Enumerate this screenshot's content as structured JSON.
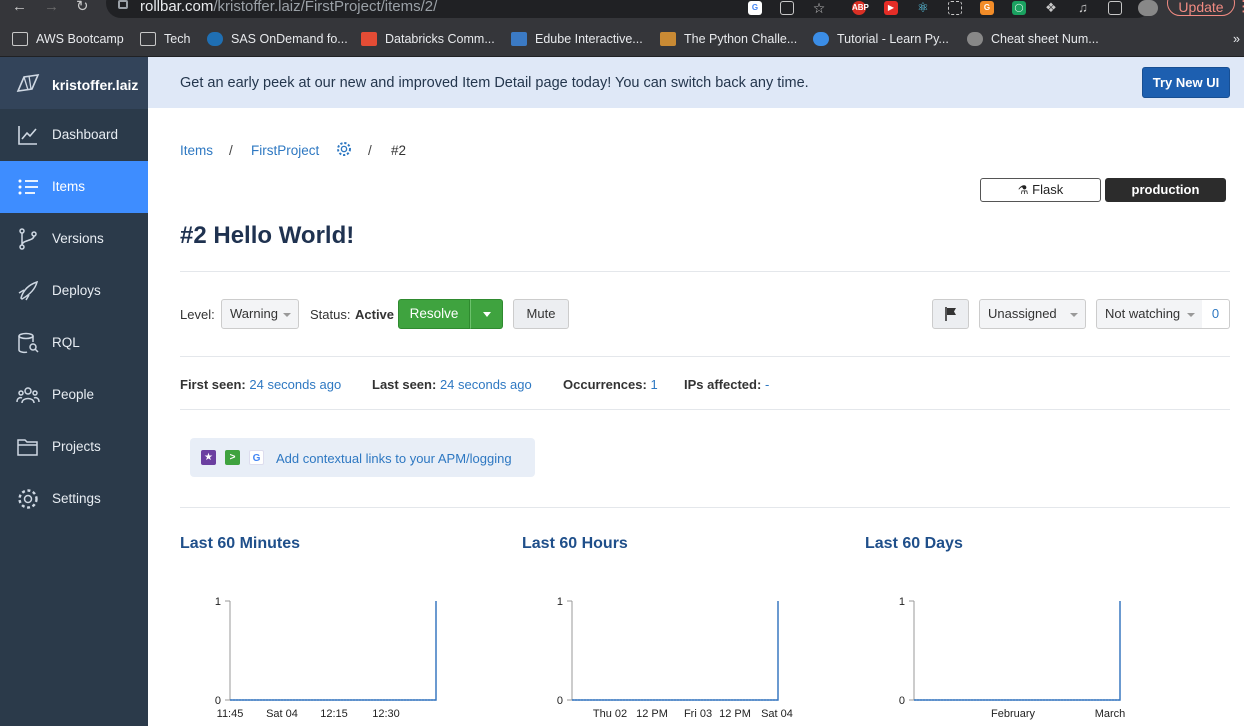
{
  "browser": {
    "url_host": "rollbar.com",
    "url_path": "/kristoffer.laiz/FirstProject/items/2/",
    "update_label": "Update",
    "bookmarks": [
      {
        "label": "AWS Bootcamp",
        "icon": "folder-icon"
      },
      {
        "label": "Tech",
        "icon": "folder-icon"
      },
      {
        "label": "SAS OnDemand fo...",
        "icon": "sas-icon"
      },
      {
        "label": "Databricks Comm...",
        "icon": "databricks-icon"
      },
      {
        "label": "Edube Interactive...",
        "icon": "edube-icon"
      },
      {
        "label": "The Python Challe...",
        "icon": "python-challenge-icon"
      },
      {
        "label": "Tutorial - Learn Py...",
        "icon": "tutorial-icon"
      },
      {
        "label": "Cheat sheet Num...",
        "icon": "globe-icon"
      }
    ],
    "more_label": "»"
  },
  "sidebar": {
    "account": "kristoffer.laiz",
    "items": [
      {
        "label": "Dashboard",
        "icon": "chart-icon",
        "active": false
      },
      {
        "label": "Items",
        "icon": "list-icon",
        "active": true
      },
      {
        "label": "Versions",
        "icon": "branch-icon",
        "active": false
      },
      {
        "label": "Deploys",
        "icon": "rocket-icon",
        "active": false
      },
      {
        "label": "RQL",
        "icon": "database-search-icon",
        "active": false
      },
      {
        "label": "People",
        "icon": "people-icon",
        "active": false
      },
      {
        "label": "Projects",
        "icon": "folders-icon",
        "active": false
      },
      {
        "label": "Settings",
        "icon": "gear-icon",
        "active": false
      }
    ]
  },
  "banner": {
    "text": "Get an early peek at our new and improved Item Detail page today! You can switch back any time.",
    "button": "Try New UI"
  },
  "breadcrumb": {
    "items": "Items",
    "sep": "/",
    "project": "FirstProject",
    "current": "#2"
  },
  "environment": {
    "framework": "Flask",
    "env": "production"
  },
  "item": {
    "title": "#2 Hello World!"
  },
  "controls": {
    "level_label": "Level:",
    "level_value": "Warning",
    "status_label": "Status:",
    "status_value": "Active",
    "resolve": "Resolve",
    "mute": "Mute",
    "assignee": "Unassigned",
    "watching": "Not watching",
    "watch_count": "0"
  },
  "meta": {
    "first_seen_label": "First seen:",
    "first_seen_value": "24 seconds ago",
    "last_seen_label": "Last seen:",
    "last_seen_value": "24 seconds ago",
    "occurrences_label": "Occurrences:",
    "occurrences_value": "1",
    "ips_label": "IPs affected:",
    "ips_value": "-"
  },
  "apm": {
    "text": "Add contextual links to your APM/logging"
  },
  "chart_data": [
    {
      "type": "line",
      "title": "Last 60 Minutes",
      "ylim": [
        0,
        1
      ],
      "yticks": [
        "0",
        "1"
      ],
      "xticks": [
        "11:45",
        "Sat 04",
        "12:15",
        "12:30"
      ],
      "values": [
        0,
        0,
        0,
        0,
        0,
        0,
        0,
        0,
        0,
        0,
        0,
        0,
        0,
        0,
        0,
        0,
        0,
        0,
        0,
        0,
        0,
        0,
        0,
        0,
        0,
        0,
        0,
        0,
        0,
        0,
        0,
        0,
        0,
        0,
        0,
        0,
        0,
        0,
        0,
        0,
        0,
        0,
        0,
        0,
        0,
        0,
        0,
        0,
        0,
        0,
        0,
        0,
        0,
        0,
        0,
        0,
        0,
        0,
        0,
        1
      ],
      "color": "#3a78c0"
    },
    {
      "type": "line",
      "title": "Last 60 Hours",
      "ylim": [
        0,
        1
      ],
      "yticks": [
        "0",
        "1"
      ],
      "xticks": [
        "Thu 02",
        "12 PM",
        "Fri 03",
        "12 PM",
        "Sat 04"
      ],
      "values": [
        0,
        0,
        0,
        0,
        0,
        0,
        0,
        0,
        0,
        0,
        0,
        0,
        0,
        0,
        0,
        0,
        0,
        0,
        0,
        0,
        0,
        0,
        0,
        0,
        0,
        0,
        0,
        0,
        0,
        0,
        0,
        0,
        0,
        0,
        0,
        0,
        0,
        0,
        0,
        0,
        0,
        0,
        0,
        0,
        0,
        0,
        0,
        0,
        0,
        0,
        0,
        0,
        0,
        0,
        0,
        0,
        0,
        0,
        0,
        1
      ],
      "color": "#3a78c0"
    },
    {
      "type": "line",
      "title": "Last 60 Days",
      "ylim": [
        0,
        1
      ],
      "yticks": [
        "0",
        "1"
      ],
      "xticks": [
        "February",
        "March"
      ],
      "values": [
        0,
        0,
        0,
        0,
        0,
        0,
        0,
        0,
        0,
        0,
        0,
        0,
        0,
        0,
        0,
        0,
        0,
        0,
        0,
        0,
        0,
        0,
        0,
        0,
        0,
        0,
        0,
        0,
        0,
        0,
        0,
        0,
        0,
        0,
        0,
        0,
        0,
        0,
        0,
        0,
        0,
        0,
        0,
        0,
        0,
        0,
        0,
        0,
        0,
        0,
        0,
        0,
        0,
        0,
        0,
        0,
        0,
        0,
        0,
        1
      ],
      "color": "#3a78c0"
    }
  ]
}
